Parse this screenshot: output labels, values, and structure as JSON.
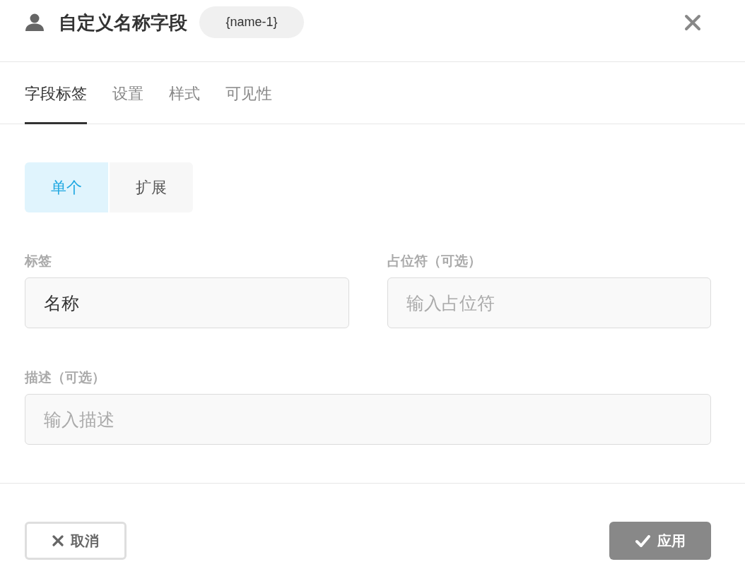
{
  "dialog": {
    "title": "自定义名称字段",
    "badge": "{name-1}"
  },
  "tabs": [
    {
      "label": "字段标签",
      "selected": true
    },
    {
      "label": "设置",
      "selected": false
    },
    {
      "label": "样式",
      "selected": false
    },
    {
      "label": "可见性",
      "selected": false
    }
  ],
  "mode_toggle": [
    {
      "label": "单个",
      "selected": true
    },
    {
      "label": "扩展",
      "selected": false
    }
  ],
  "fields": [
    {
      "label": "标签",
      "value": "名称"
    },
    {
      "label": "占位符（可选）",
      "placeholder": "输入占位符"
    }
  ],
  "description_field": {
    "label": "描述（可选）",
    "placeholder": "输入描述"
  },
  "buttons": [
    {
      "kind": "cancel",
      "label": "取消"
    },
    {
      "kind": "apply",
      "label": "应用"
    }
  ]
}
